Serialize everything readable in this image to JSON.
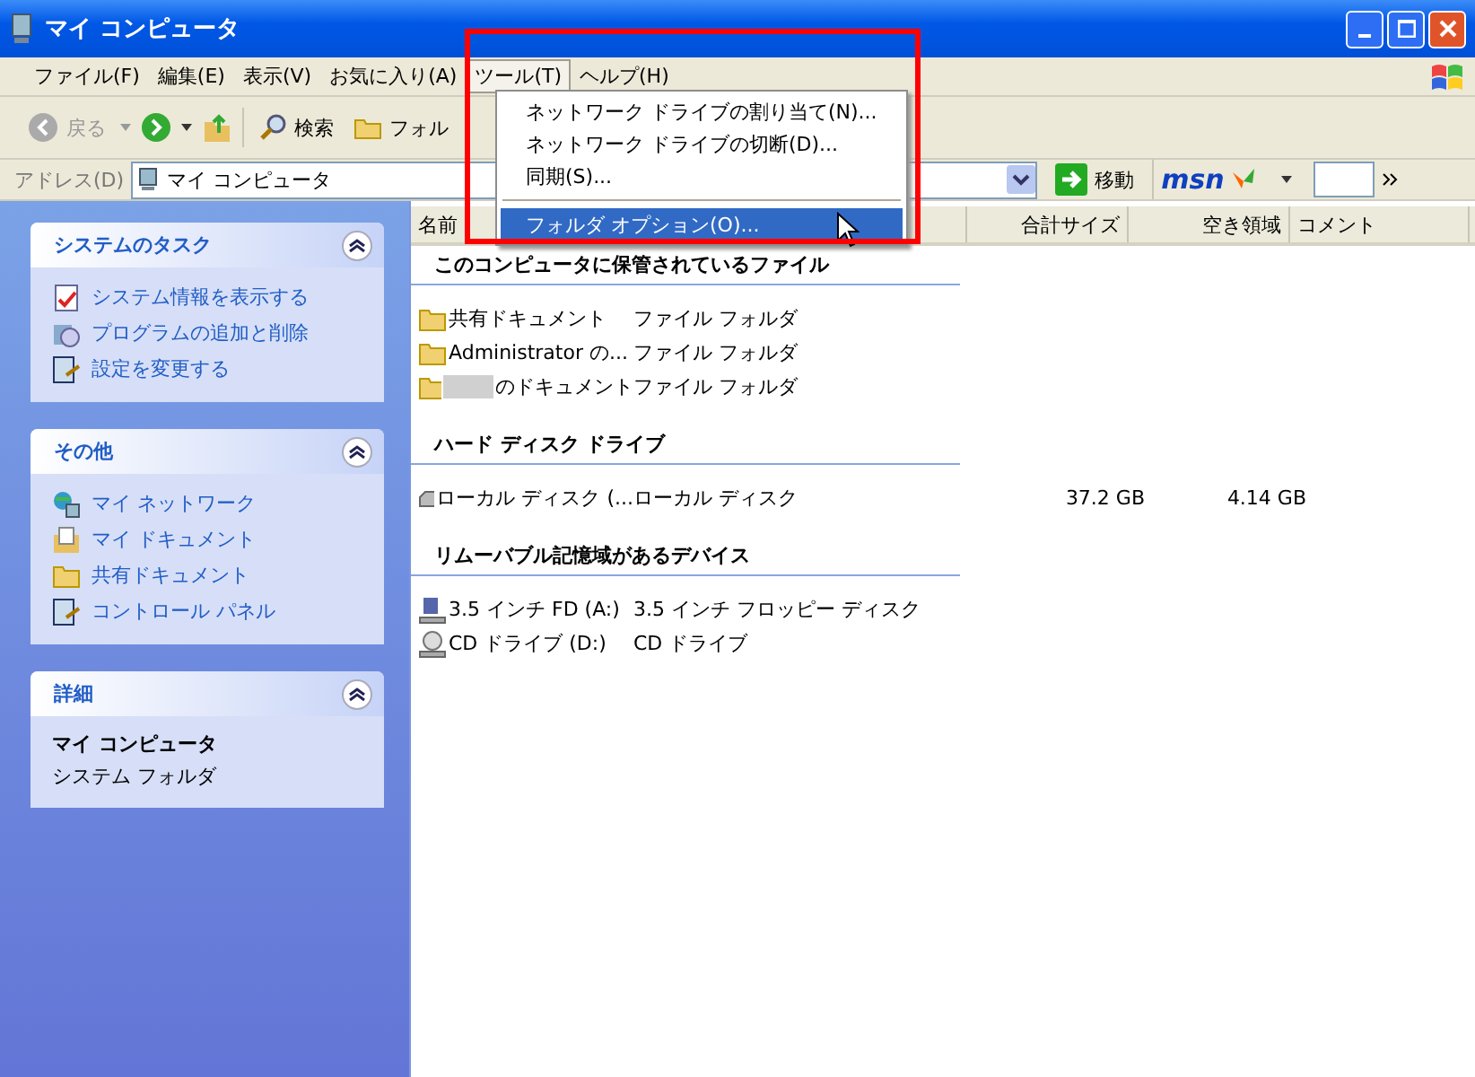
{
  "window": {
    "title": "マイ コンピュータ"
  },
  "menu_bar": [
    {
      "label": "ファイル(F)",
      "selected": false
    },
    {
      "label": "編集(E)",
      "selected": false
    },
    {
      "label": "表示(V)",
      "selected": false
    },
    {
      "label": "お気に入り(A)",
      "selected": false
    },
    {
      "label": "ツール(T)",
      "selected": true
    },
    {
      "label": "ヘルプ(H)",
      "selected": false
    }
  ],
  "tools_menu": [
    {
      "kind": "item",
      "label": "ネットワーク ドライブの割り当て(N)...",
      "selected": false
    },
    {
      "kind": "item",
      "label": "ネットワーク ドライブの切断(D)...",
      "selected": false
    },
    {
      "kind": "item",
      "label": "同期(S)...",
      "selected": false
    },
    {
      "kind": "separator"
    },
    {
      "kind": "item",
      "label": "フォルダ オプション(O)...",
      "selected": true
    }
  ],
  "toolbar": {
    "back": {
      "label": "戻る",
      "disabled": true
    },
    "search": "検索",
    "folders": "フォル"
  },
  "address_bar": {
    "label": "アドレス(D)",
    "value": "マイ コンピュータ",
    "go": "移動",
    "logo": "msn"
  },
  "task_panes": [
    {
      "title": "システムのタスク",
      "items": [
        {
          "kind": "sysinfo",
          "label": "システム情報を表示する"
        },
        {
          "kind": "programs",
          "label": "プログラムの追加と削除"
        },
        {
          "kind": "settings",
          "label": "設定を変更する"
        }
      ]
    },
    {
      "title": "その他",
      "items": [
        {
          "kind": "network",
          "label": "マイ ネットワーク"
        },
        {
          "kind": "documents",
          "label": "マイ ドキュメント"
        },
        {
          "kind": "folder",
          "label": "共有ドキュメント"
        },
        {
          "kind": "settings",
          "label": "コントロール パネル"
        }
      ]
    },
    {
      "title": "詳細",
      "details": {
        "name": "マイ コンピュータ",
        "type": "システム フォルダ"
      }
    }
  ],
  "columns": [
    {
      "label": "名前"
    },
    {
      "label": "合計サイズ"
    },
    {
      "label": "空き領域"
    },
    {
      "label": "コメント"
    }
  ],
  "groups": [
    {
      "title": "このコンピュータに保管されているファイル",
      "rows": [
        {
          "kind": "folder",
          "name": "共有ドキュメント",
          "blurred": false,
          "type": "ファイル フォルダ"
        },
        {
          "kind": "folder",
          "name": "Administrator の...",
          "blurred": false,
          "type": "ファイル フォルダ"
        },
        {
          "kind": "folder",
          "name": "のドキュメント",
          "blurred": true,
          "type": "ファイル フォルダ"
        }
      ]
    },
    {
      "title": "ハード ディスク ドライブ",
      "rows": [
        {
          "kind": "disk",
          "name": "ローカル ディスク (...",
          "blurred": false,
          "type": "ローカル ディスク",
          "total": "37.2 GB",
          "free": "4.14 GB"
        }
      ]
    },
    {
      "title": "リムーバブル記憶域があるデバイス",
      "rows": [
        {
          "kind": "floppy",
          "name": "3.5 インチ FD (A:)",
          "blurred": false,
          "type": "3.5 インチ フロッピー ディスク"
        },
        {
          "kind": "cd",
          "name": "CD ドライブ (D:)",
          "blurred": false,
          "type": "CD ドライブ"
        }
      ]
    }
  ]
}
